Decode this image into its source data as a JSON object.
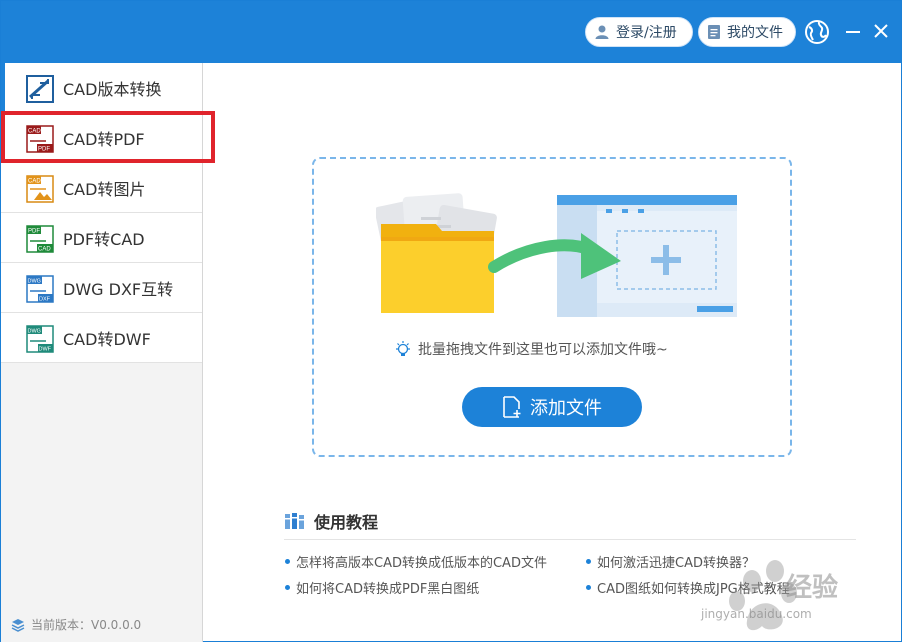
{
  "header": {
    "login_label": "登录/注册",
    "files_label": "我的文件",
    "accent": "#1d82d8"
  },
  "sidebar": {
    "items": [
      {
        "label": "CAD版本转换",
        "icon": "cad-version-icon"
      },
      {
        "label": "CAD转PDF",
        "icon": "cad-to-pdf-icon"
      },
      {
        "label": "CAD转图片",
        "icon": "cad-to-image-icon"
      },
      {
        "label": "PDF转CAD",
        "icon": "pdf-to-cad-icon"
      },
      {
        "label": "DWG DXF互转",
        "icon": "dwg-dxf-icon"
      },
      {
        "label": "CAD转DWF",
        "icon": "cad-to-dwf-icon"
      }
    ],
    "version": "当前版本：V0.0.0.0"
  },
  "main": {
    "hint": "批量拖拽文件到这里也可以添加文件哦~",
    "add_button": "添加文件"
  },
  "tutorials": {
    "title": "使用教程",
    "links": [
      "怎样将高版本CAD转换成低版本的CAD文件",
      "如何激活迅捷CAD转换器？",
      "如何将CAD转换成PDF黑白图纸",
      "CAD图纸如何转换成JPG格式教程"
    ]
  },
  "watermark": {
    "text": "经验",
    "url": "jingyan.baidu.com"
  }
}
